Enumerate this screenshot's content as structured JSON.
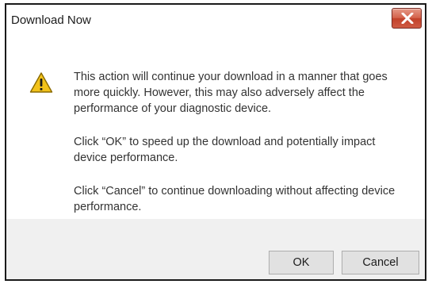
{
  "dialog": {
    "title": "Download Now",
    "icon": "warning-icon",
    "close_icon": "close-icon",
    "messages": [
      "This action will continue your download in a manner that goes more quickly. However, this may also adversely affect the performance of your diagnostic device.",
      "Click “OK” to speed up the download and potentially impact device performance.",
      "Click “Cancel” to continue downloading without affecting device performance."
    ],
    "ok_label": "OK",
    "cancel_label": "Cancel"
  },
  "colors": {
    "close_button": "#c8432b",
    "footer": "#f0f0f0",
    "warning_fill": "#f2c21a"
  }
}
